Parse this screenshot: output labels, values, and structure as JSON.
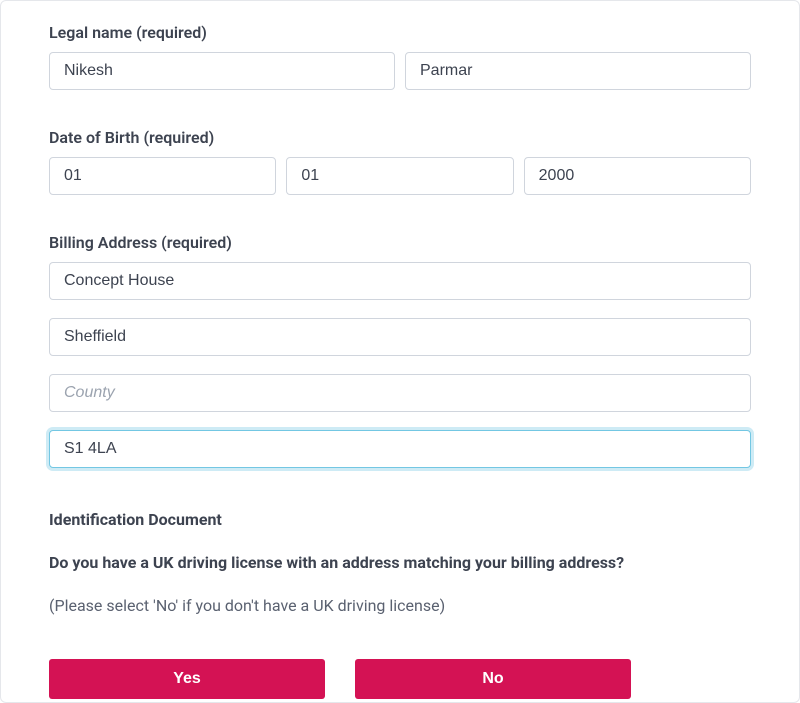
{
  "legalName": {
    "label": "Legal name (required)",
    "first": "Nikesh",
    "last": "Parmar"
  },
  "dob": {
    "label": "Date of Birth (required)",
    "day": "01",
    "month": "01",
    "year": "2000"
  },
  "billing": {
    "label": "Billing Address (required)",
    "line1": "Concept House",
    "city": "Sheffield",
    "county": "",
    "county_placeholder": "County",
    "postcode": "S1 4LA"
  },
  "identification": {
    "heading": "Identification Document",
    "question": "Do you have a UK driving license with an address matching your billing address?",
    "hint": "(Please select 'No' if you don't have a UK driving license)",
    "yes_label": "Yes",
    "no_label": "No"
  },
  "colors": {
    "accent": "#d41254",
    "focus_ring": "#73c7e3",
    "text": "#3d4350",
    "border": "#d0d5dd"
  }
}
